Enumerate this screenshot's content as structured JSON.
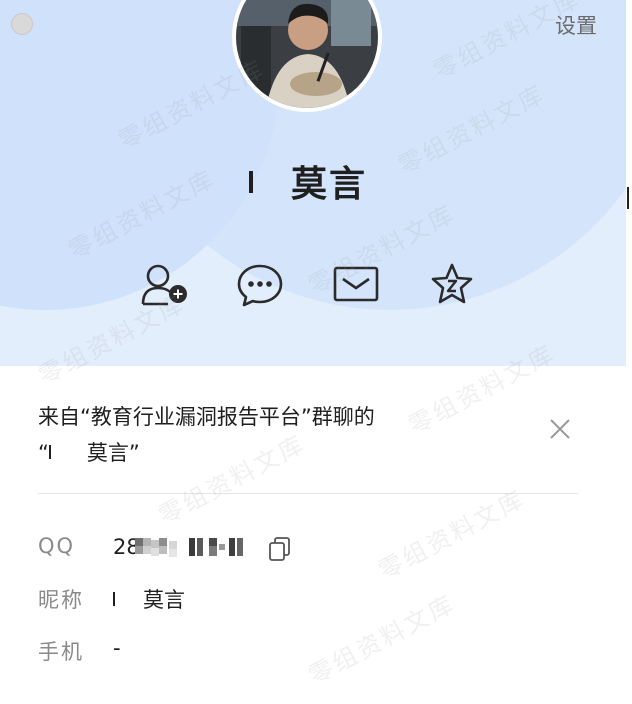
{
  "window": {
    "settings_label": "设置"
  },
  "profile": {
    "name": "莫言"
  },
  "actions": [
    {
      "name": "add-friend-icon"
    },
    {
      "name": "message-icon"
    },
    {
      "name": "mail-icon"
    },
    {
      "name": "favorite-icon"
    }
  ],
  "source": {
    "title": "来自“教育行业漏洞报告平台”群聊的",
    "quote_open": "“",
    "name": "莫言",
    "quote_close": "”"
  },
  "info": {
    "qq": {
      "label": "QQ",
      "value_visible": "28"
    },
    "nickname": {
      "label": "昵称",
      "value": "莫言"
    },
    "phone": {
      "label": "手机",
      "value": "-"
    }
  },
  "watermark": "零组资料文库"
}
